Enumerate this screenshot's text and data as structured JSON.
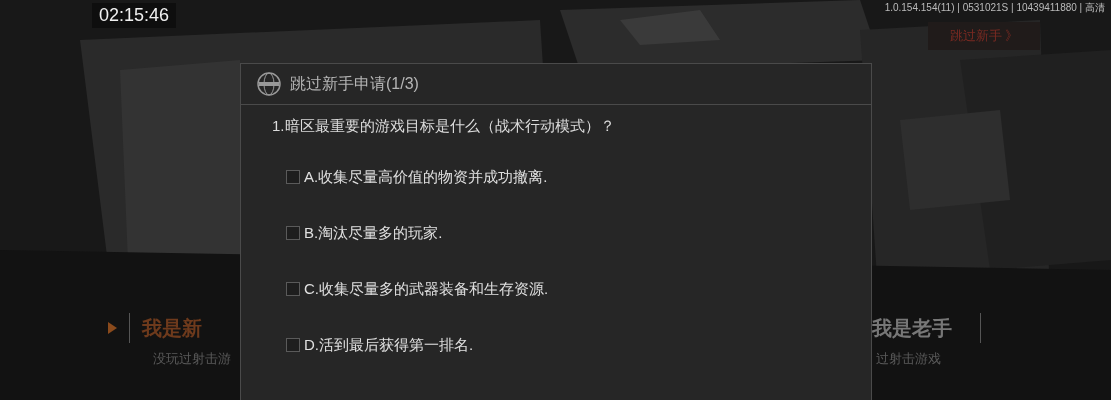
{
  "timer": "02:15:46",
  "version_info": "1.0.154.154(11) | 0531021S | 10439411880 | 高清",
  "skip_button": {
    "label": "跳过新手 》"
  },
  "modes": [
    {
      "title": "我是新",
      "subtitle": "没玩过射击游",
      "selected": true
    },
    {
      "title": "我是老手",
      "subtitle": "过射击游戏",
      "selected": false
    }
  ],
  "dialog": {
    "title": "跳过新手申请(1/3)",
    "question": "1.暗区最重要的游戏目标是什么（战术行动模式）？",
    "options": [
      {
        "label": "A.收集尽量高价值的物资并成功撤离.",
        "checked": false
      },
      {
        "label": "B.淘汰尽量多的玩家.",
        "checked": false
      },
      {
        "label": "C.收集尽量多的武器装备和生存资源.",
        "checked": false
      },
      {
        "label": "D.活到最后获得第一排名.",
        "checked": false
      }
    ]
  }
}
